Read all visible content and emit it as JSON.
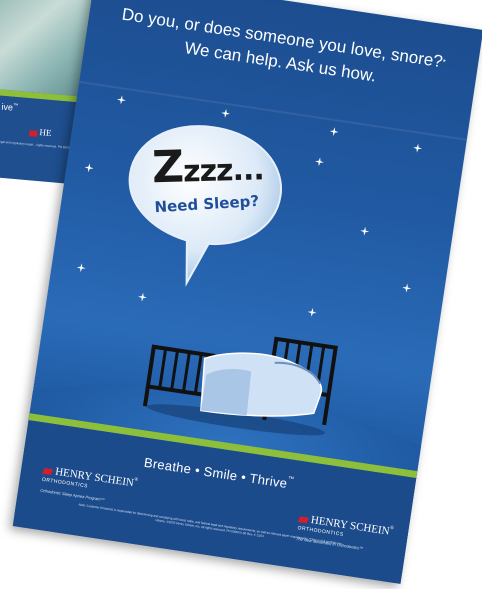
{
  "back_poster": {
    "tagline_fragment": "ive",
    "tm": "™",
    "logo_fragment": "HE",
    "fine_print_fragment": "legal and regulatory requir... rights reserved. PN 5000..."
  },
  "poster": {
    "headline_line1": "Do you, or does someone you love, snore?",
    "headline_sup": "*",
    "headline_line2": "We can help. Ask us how.",
    "bubble_z_big": "Z",
    "bubble_z_rest": "zzz...",
    "bubble_sub": "Need Sleep?",
    "tagline": "Breathe • Smile • Thrive",
    "tagline_tm": "™",
    "left_logo": {
      "name": "HENRY SCHEIN",
      "reg": "®",
      "sub": "ORTHODONTICS",
      "slogan": "Orthodontic Sleep Apnea Program™"
    },
    "right_logo": {
      "name": "HENRY SCHEIN",
      "reg": "®",
      "sub": "ORTHODONTICS",
      "slogan": "The New Movement In Orthodontics™"
    },
    "fine_print": "Note: Customer (Practice) is responsible for determining and complying with local, state, and federal legal and regulatory requirements, as well as relevant payer requirements. *Only on full portfolio per volume. ©2020 Henry Schein, Inc. All rights reserved. PN 5000XX-00 Rev. X 12/21"
  },
  "colors": {
    "poster_blue": "#1f5aa3",
    "footer_blue": "#1c4b8c",
    "green_band": "#8dbf3a",
    "logo_red": "#d11f2c"
  },
  "icons": [
    "star-icon",
    "speech-bubble-icon",
    "bed-icon",
    "henry-schein-logo-icon"
  ]
}
